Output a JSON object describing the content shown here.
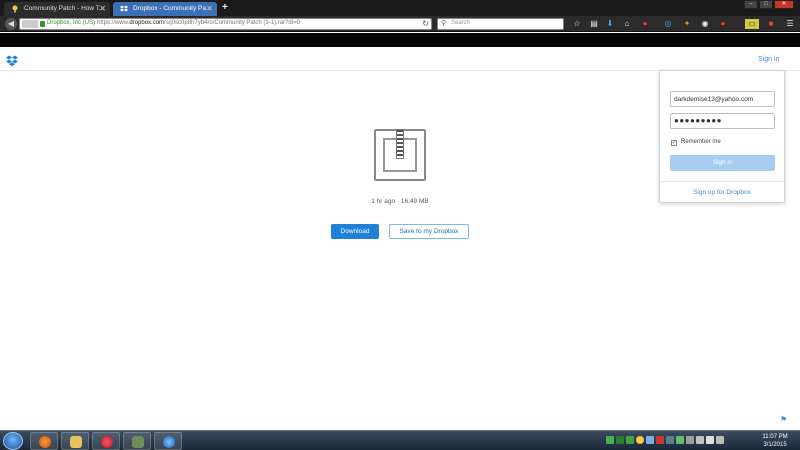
{
  "browser": {
    "tabs": [
      {
        "title": "Community Patch - How T...",
        "active": false
      },
      {
        "title": "Dropbox - Community Pa...",
        "active": true
      }
    ],
    "new_tab_label": "+",
    "identity": "Dropbox, Inc (US)",
    "url_prefix": "https://www.",
    "url_domain": "dropbox.com",
    "url_rest": "/s/j0sc0p8h7yb4ro/Community Patch (3-1).rar?dl=0",
    "search_placeholder": "Search"
  },
  "page": {
    "header_signin": "Sign in",
    "file_meta": "1 hr ago · 16.49 MB",
    "download_label": "Download",
    "save_label": "Save to my Dropbox"
  },
  "signin_popup": {
    "email_value": "darkdemise13@yahoo.com",
    "password_mask": "●●●●●●●●●",
    "remember_label": "Remember me",
    "remember_checked": true,
    "remember_mark": "✓",
    "signin_button": "Sign in",
    "signup_link": "Sign up for Dropbox"
  },
  "taskbar": {
    "time": "11:07 PM",
    "date": "3/1/2015"
  },
  "colors": {
    "accent": "#1f82d8",
    "link": "#3d8fd6",
    "secure": "#3a8f2f"
  }
}
